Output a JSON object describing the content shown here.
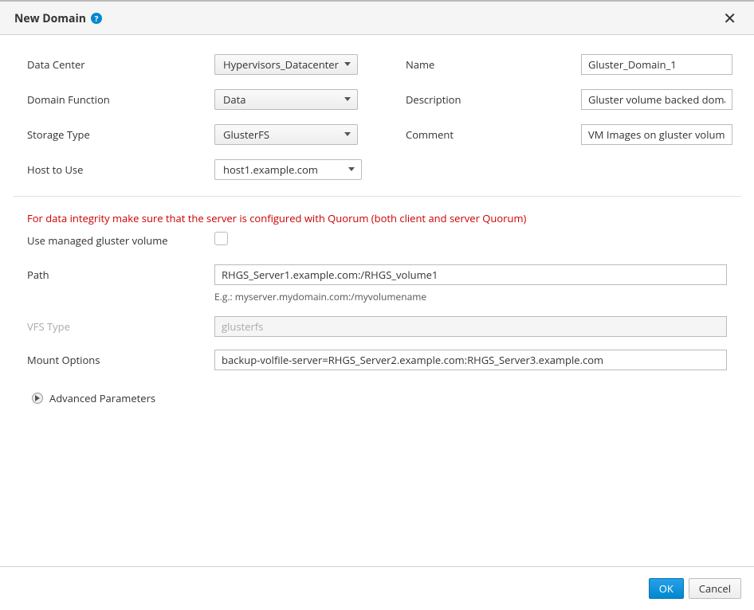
{
  "dialog": {
    "title": "New Domain",
    "help_tooltip": "?"
  },
  "form": {
    "data_center": {
      "label": "Data Center",
      "value": "Hypervisors_Datacenter"
    },
    "domain_function": {
      "label": "Domain Function",
      "value": "Data"
    },
    "storage_type": {
      "label": "Storage Type",
      "value": "GlusterFS"
    },
    "host_to_use": {
      "label": "Host to Use",
      "value": "host1.example.com"
    },
    "name": {
      "label": "Name",
      "value": "Gluster_Domain_1"
    },
    "description": {
      "label": "Description",
      "value": "Gluster volume backed domain"
    },
    "comment": {
      "label": "Comment",
      "value": "VM Images on gluster volume"
    }
  },
  "gluster": {
    "warning": "For data integrity make sure that the server is configured with Quorum (both client and server Quorum)",
    "use_managed_label": "Use managed gluster volume",
    "use_managed_checked": false,
    "path": {
      "label": "Path",
      "value": "RHGS_Server1.example.com:/RHGS_volume1",
      "hint": "E.g.: myserver.mydomain.com:/myvolumename"
    },
    "vfs_type": {
      "label": "VFS Type",
      "value": "glusterfs"
    },
    "mount_options": {
      "label": "Mount Options",
      "value": "backup-volfile-server=RHGS_Server2.example.com:RHGS_Server3.example.com"
    },
    "advanced_label": "Advanced Parameters"
  },
  "buttons": {
    "ok": "OK",
    "cancel": "Cancel"
  }
}
